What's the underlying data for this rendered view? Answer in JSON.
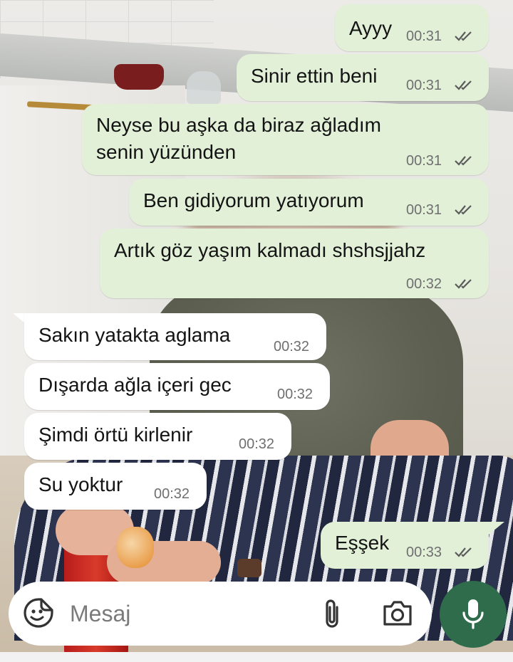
{
  "messages": [
    {
      "direction": "outgoing",
      "text": "Ayyy",
      "time": "00:31",
      "status": "read"
    },
    {
      "direction": "outgoing",
      "text": "Sinir ettin beni",
      "time": "00:31",
      "status": "read"
    },
    {
      "direction": "outgoing",
      "lines": [
        "Neyse bu aşka da biraz ağladım",
        "senin yüzünden"
      ],
      "time": "00:31",
      "status": "read"
    },
    {
      "direction": "outgoing",
      "text": "Ben gidiyorum yatıyorum",
      "time": "00:31",
      "status": "read"
    },
    {
      "direction": "outgoing",
      "text": "Artık göz yaşım kalmadı shshsjjahz",
      "time": "00:32",
      "status": "read"
    },
    {
      "direction": "incoming",
      "text": "Sakın yatakta aglama",
      "time": "00:32"
    },
    {
      "direction": "incoming",
      "text": "Dışarda ağla içeri gec",
      "time": "00:32"
    },
    {
      "direction": "incoming",
      "text": "Şimdi örtü kirlenir",
      "time": "00:32"
    },
    {
      "direction": "incoming",
      "text": "Su yoktur",
      "time": "00:32"
    },
    {
      "direction": "outgoing",
      "text": "Eşşek",
      "time": "00:33",
      "status": "read"
    }
  ],
  "composer": {
    "placeholder": "Mesaj",
    "icons": [
      "sticker-icon",
      "attach-icon",
      "camera-icon",
      "mic-icon"
    ]
  },
  "colors": {
    "outgoing_bubble": "#e2f0d8",
    "incoming_bubble": "#ffffff",
    "mic_button": "#2f6c4b",
    "read_ticks": "#5b5b5b"
  }
}
